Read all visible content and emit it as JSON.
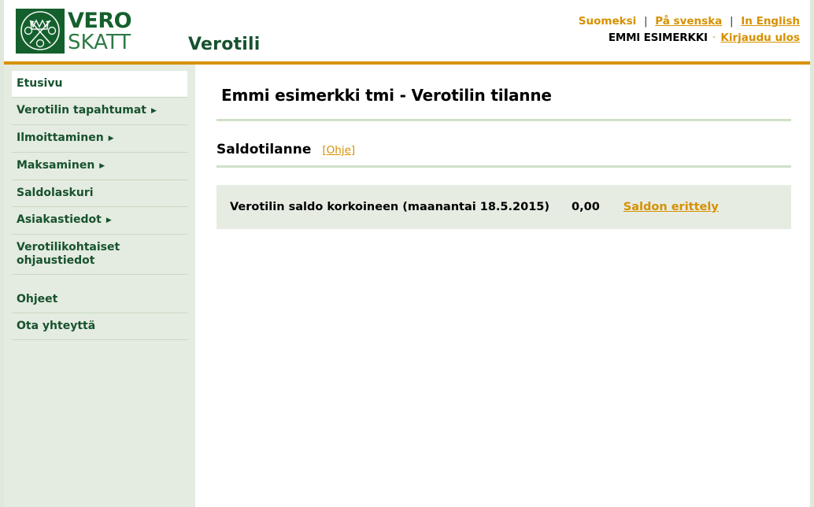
{
  "header": {
    "logo": {
      "icon": "vero-skatt-coat-of-arms-icon",
      "line1": "VERO",
      "line2": "SKATT"
    },
    "app_title": "Verotili",
    "languages": [
      {
        "label": "Suomeksi",
        "current": true
      },
      {
        "label": "På svenska",
        "current": false
      },
      {
        "label": "In English",
        "current": false
      }
    ],
    "separator": "|",
    "user_name": "EMMI ESIMERKKI",
    "user_dash": "-",
    "logout_label": "Kirjaudu ulos"
  },
  "sidebar": {
    "primary_items": [
      {
        "label": "Etusivu",
        "has_arrow": false,
        "active": true
      },
      {
        "label": "Verotilin tapahtumat",
        "has_arrow": true,
        "active": false
      },
      {
        "label": "Ilmoittaminen",
        "has_arrow": true,
        "active": false
      },
      {
        "label": "Maksaminen",
        "has_arrow": true,
        "active": false
      },
      {
        "label": "Saldolaskuri",
        "has_arrow": false,
        "active": false
      },
      {
        "label": "Asiakastiedot",
        "has_arrow": true,
        "active": false
      },
      {
        "label": "Verotilikohtaiset ohjaustiedot",
        "has_arrow": false,
        "active": false
      }
    ],
    "secondary_items": [
      {
        "label": "Ohjeet"
      },
      {
        "label": "Ota yhteyttä"
      }
    ],
    "arrow_glyph": "▶"
  },
  "main": {
    "page_title": "Emmi esimerkki tmi - Verotilin tilanne",
    "section_title": "Saldotilanne",
    "section_help_open": "[",
    "section_help_label": "Ohje",
    "section_help_close": "]",
    "balance": {
      "label": "Verotilin saldo korkoineen (maanantai 18.5.2015)",
      "amount": "0,00",
      "detail_link": "Saldon erittely"
    }
  },
  "colors": {
    "brand_green": "#14602c",
    "accent_orange": "#d79000",
    "sidebar_bg": "#e4ebe0",
    "panel_bg": "#e6ece2",
    "rule_green": "#cfe0c9"
  }
}
